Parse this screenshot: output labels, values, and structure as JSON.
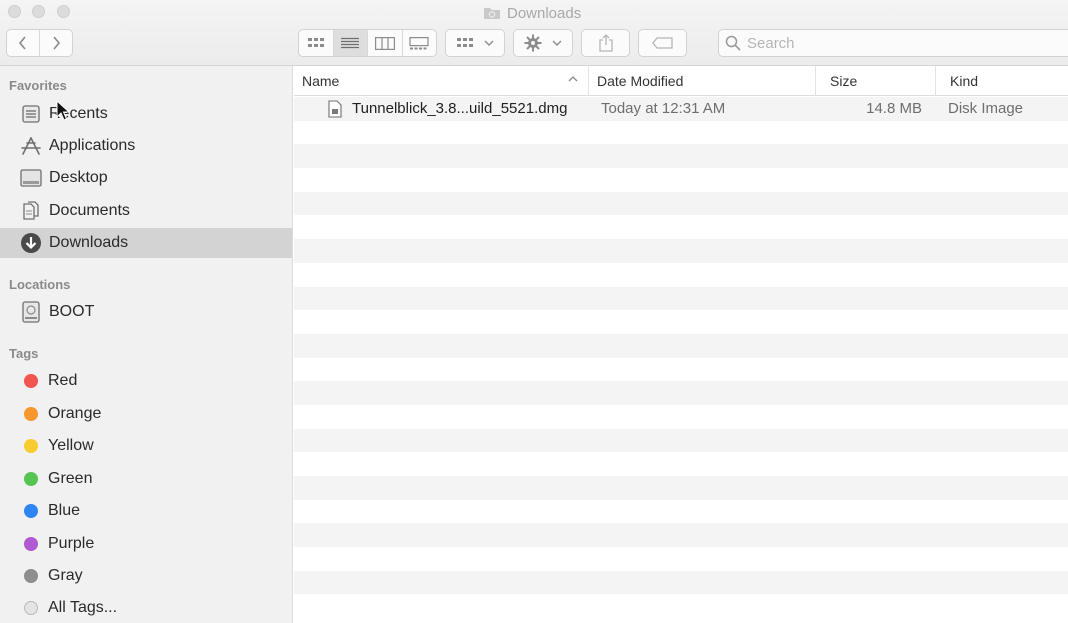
{
  "window": {
    "title": "Downloads"
  },
  "toolbar": {
    "search_placeholder": "Search"
  },
  "sidebar": {
    "favorites_title": "Favorites",
    "favorites": [
      {
        "label": "Recents",
        "icon": "recents-icon"
      },
      {
        "label": "Applications",
        "icon": "applications-icon"
      },
      {
        "label": "Desktop",
        "icon": "desktop-icon"
      },
      {
        "label": "Documents",
        "icon": "documents-icon"
      },
      {
        "label": "Downloads",
        "icon": "downloads-icon",
        "selected": true
      }
    ],
    "locations_title": "Locations",
    "locations": [
      {
        "label": "BOOT",
        "icon": "disk-icon"
      }
    ],
    "tags_title": "Tags",
    "tags": [
      {
        "label": "Red",
        "color": "#f2544e"
      },
      {
        "label": "Orange",
        "color": "#f7962d"
      },
      {
        "label": "Yellow",
        "color": "#f8cb2e"
      },
      {
        "label": "Green",
        "color": "#56c450"
      },
      {
        "label": "Blue",
        "color": "#2f84f3"
      },
      {
        "label": "Purple",
        "color": "#b258d0"
      },
      {
        "label": "Gray",
        "color": "#8e8e8e"
      },
      {
        "label": "All Tags...",
        "color": "#d9d9d9"
      }
    ]
  },
  "columns": {
    "name": "Name",
    "date_modified": "Date Modified",
    "size": "Size",
    "kind": "Kind"
  },
  "files": [
    {
      "name": "Tunnelblick_3.8...uild_5521.dmg",
      "date_modified": "Today at 12:31 AM",
      "size": "14.8 MB",
      "kind": "Disk Image"
    }
  ]
}
